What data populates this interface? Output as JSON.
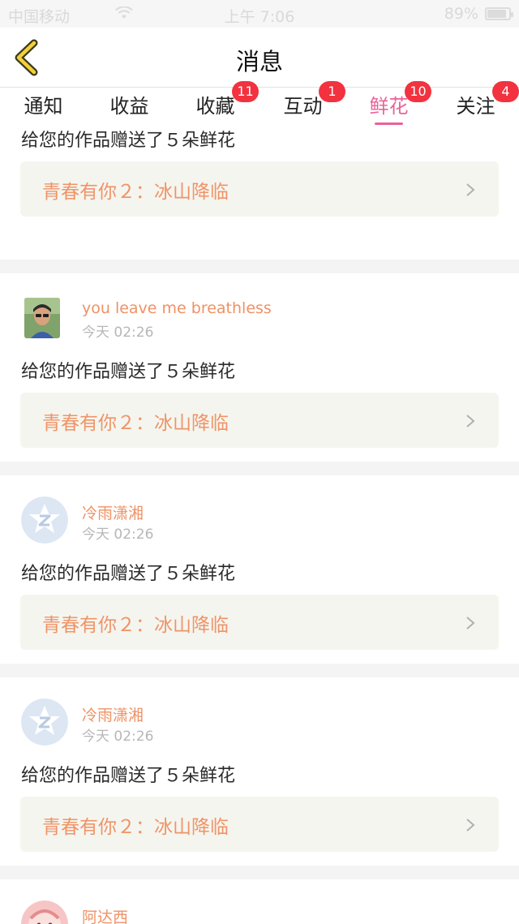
{
  "status_bar": {
    "carrier": "中国移动",
    "time": "上午 7:06",
    "battery_text": "89%",
    "battery_level": 0.89
  },
  "nav": {
    "title": "消息"
  },
  "tabs": [
    {
      "label": "通知",
      "badge": "",
      "active": false
    },
    {
      "label": "收益",
      "badge": "",
      "active": false
    },
    {
      "label": "收藏",
      "badge": "11",
      "active": false
    },
    {
      "label": "互动",
      "badge": "1",
      "active": false
    },
    {
      "label": "鲜花",
      "badge": "10",
      "active": true
    },
    {
      "label": "关注",
      "badge": "4",
      "active": false
    }
  ],
  "colors": {
    "accent": "#e9629a",
    "badge": "#f2323f",
    "username": "#ee9265",
    "work_title": "#ef9468"
  },
  "messages": [
    {
      "username": "",
      "time": "",
      "avatar": "partial-avatar",
      "text": "给您的作品赠送了５朵鲜花",
      "work_title": "青春有你２：冰山降临"
    },
    {
      "username": "you leave me breathless",
      "time": "今天 02:26",
      "avatar": "user-photo",
      "text": "给您的作品赠送了５朵鲜花",
      "work_title": "青春有你２：冰山降临"
    },
    {
      "username": "冷雨潇湘",
      "time": "今天 02:26",
      "avatar": "qq-default-avatar",
      "text": "给您的作品赠送了５朵鲜花",
      "work_title": "青春有你２：冰山降临"
    },
    {
      "username": "冷雨潇湘",
      "time": "今天 02:26",
      "avatar": "qq-default-avatar",
      "text": "给您的作品赠送了５朵鲜花",
      "work_title": "青春有你２：冰山降临"
    },
    {
      "username": "阿达西",
      "time": "",
      "avatar": "pink-cartoon-avatar",
      "text": "",
      "work_title": ""
    }
  ]
}
